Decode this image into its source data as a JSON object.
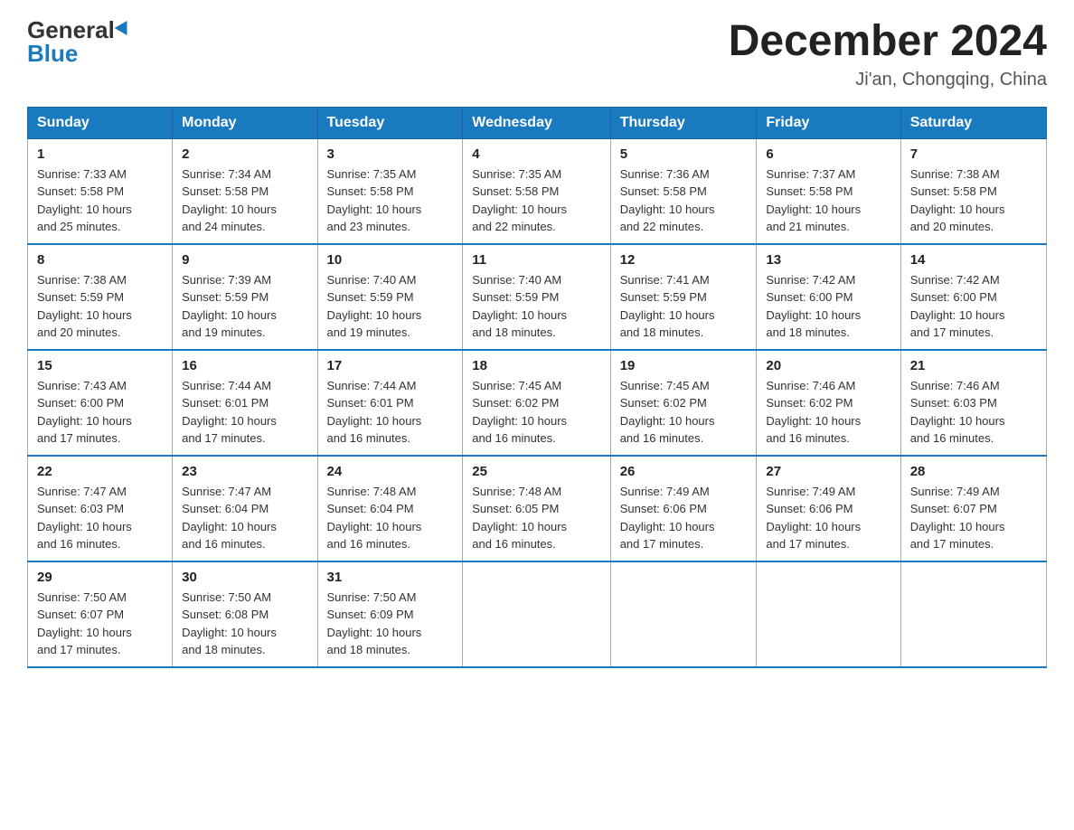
{
  "header": {
    "logo_general": "General",
    "logo_blue": "Blue",
    "month_title": "December 2024",
    "subtitle": "Ji'an, Chongqing, China"
  },
  "weekdays": [
    "Sunday",
    "Monday",
    "Tuesday",
    "Wednesday",
    "Thursday",
    "Friday",
    "Saturday"
  ],
  "weeks": [
    [
      {
        "day": "1",
        "sunrise": "7:33 AM",
        "sunset": "5:58 PM",
        "daylight": "10 hours and 25 minutes."
      },
      {
        "day": "2",
        "sunrise": "7:34 AM",
        "sunset": "5:58 PM",
        "daylight": "10 hours and 24 minutes."
      },
      {
        "day": "3",
        "sunrise": "7:35 AM",
        "sunset": "5:58 PM",
        "daylight": "10 hours and 23 minutes."
      },
      {
        "day": "4",
        "sunrise": "7:35 AM",
        "sunset": "5:58 PM",
        "daylight": "10 hours and 22 minutes."
      },
      {
        "day": "5",
        "sunrise": "7:36 AM",
        "sunset": "5:58 PM",
        "daylight": "10 hours and 22 minutes."
      },
      {
        "day": "6",
        "sunrise": "7:37 AM",
        "sunset": "5:58 PM",
        "daylight": "10 hours and 21 minutes."
      },
      {
        "day": "7",
        "sunrise": "7:38 AM",
        "sunset": "5:58 PM",
        "daylight": "10 hours and 20 minutes."
      }
    ],
    [
      {
        "day": "8",
        "sunrise": "7:38 AM",
        "sunset": "5:59 PM",
        "daylight": "10 hours and 20 minutes."
      },
      {
        "day": "9",
        "sunrise": "7:39 AM",
        "sunset": "5:59 PM",
        "daylight": "10 hours and 19 minutes."
      },
      {
        "day": "10",
        "sunrise": "7:40 AM",
        "sunset": "5:59 PM",
        "daylight": "10 hours and 19 minutes."
      },
      {
        "day": "11",
        "sunrise": "7:40 AM",
        "sunset": "5:59 PM",
        "daylight": "10 hours and 18 minutes."
      },
      {
        "day": "12",
        "sunrise": "7:41 AM",
        "sunset": "5:59 PM",
        "daylight": "10 hours and 18 minutes."
      },
      {
        "day": "13",
        "sunrise": "7:42 AM",
        "sunset": "6:00 PM",
        "daylight": "10 hours and 18 minutes."
      },
      {
        "day": "14",
        "sunrise": "7:42 AM",
        "sunset": "6:00 PM",
        "daylight": "10 hours and 17 minutes."
      }
    ],
    [
      {
        "day": "15",
        "sunrise": "7:43 AM",
        "sunset": "6:00 PM",
        "daylight": "10 hours and 17 minutes."
      },
      {
        "day": "16",
        "sunrise": "7:44 AM",
        "sunset": "6:01 PM",
        "daylight": "10 hours and 17 minutes."
      },
      {
        "day": "17",
        "sunrise": "7:44 AM",
        "sunset": "6:01 PM",
        "daylight": "10 hours and 16 minutes."
      },
      {
        "day": "18",
        "sunrise": "7:45 AM",
        "sunset": "6:02 PM",
        "daylight": "10 hours and 16 minutes."
      },
      {
        "day": "19",
        "sunrise": "7:45 AM",
        "sunset": "6:02 PM",
        "daylight": "10 hours and 16 minutes."
      },
      {
        "day": "20",
        "sunrise": "7:46 AM",
        "sunset": "6:02 PM",
        "daylight": "10 hours and 16 minutes."
      },
      {
        "day": "21",
        "sunrise": "7:46 AM",
        "sunset": "6:03 PM",
        "daylight": "10 hours and 16 minutes."
      }
    ],
    [
      {
        "day": "22",
        "sunrise": "7:47 AM",
        "sunset": "6:03 PM",
        "daylight": "10 hours and 16 minutes."
      },
      {
        "day": "23",
        "sunrise": "7:47 AM",
        "sunset": "6:04 PM",
        "daylight": "10 hours and 16 minutes."
      },
      {
        "day": "24",
        "sunrise": "7:48 AM",
        "sunset": "6:04 PM",
        "daylight": "10 hours and 16 minutes."
      },
      {
        "day": "25",
        "sunrise": "7:48 AM",
        "sunset": "6:05 PM",
        "daylight": "10 hours and 16 minutes."
      },
      {
        "day": "26",
        "sunrise": "7:49 AM",
        "sunset": "6:06 PM",
        "daylight": "10 hours and 17 minutes."
      },
      {
        "day": "27",
        "sunrise": "7:49 AM",
        "sunset": "6:06 PM",
        "daylight": "10 hours and 17 minutes."
      },
      {
        "day": "28",
        "sunrise": "7:49 AM",
        "sunset": "6:07 PM",
        "daylight": "10 hours and 17 minutes."
      }
    ],
    [
      {
        "day": "29",
        "sunrise": "7:50 AM",
        "sunset": "6:07 PM",
        "daylight": "10 hours and 17 minutes."
      },
      {
        "day": "30",
        "sunrise": "7:50 AM",
        "sunset": "6:08 PM",
        "daylight": "10 hours and 18 minutes."
      },
      {
        "day": "31",
        "sunrise": "7:50 AM",
        "sunset": "6:09 PM",
        "daylight": "10 hours and 18 minutes."
      },
      null,
      null,
      null,
      null
    ]
  ],
  "labels": {
    "sunrise": "Sunrise:",
    "sunset": "Sunset:",
    "daylight": "Daylight:"
  }
}
